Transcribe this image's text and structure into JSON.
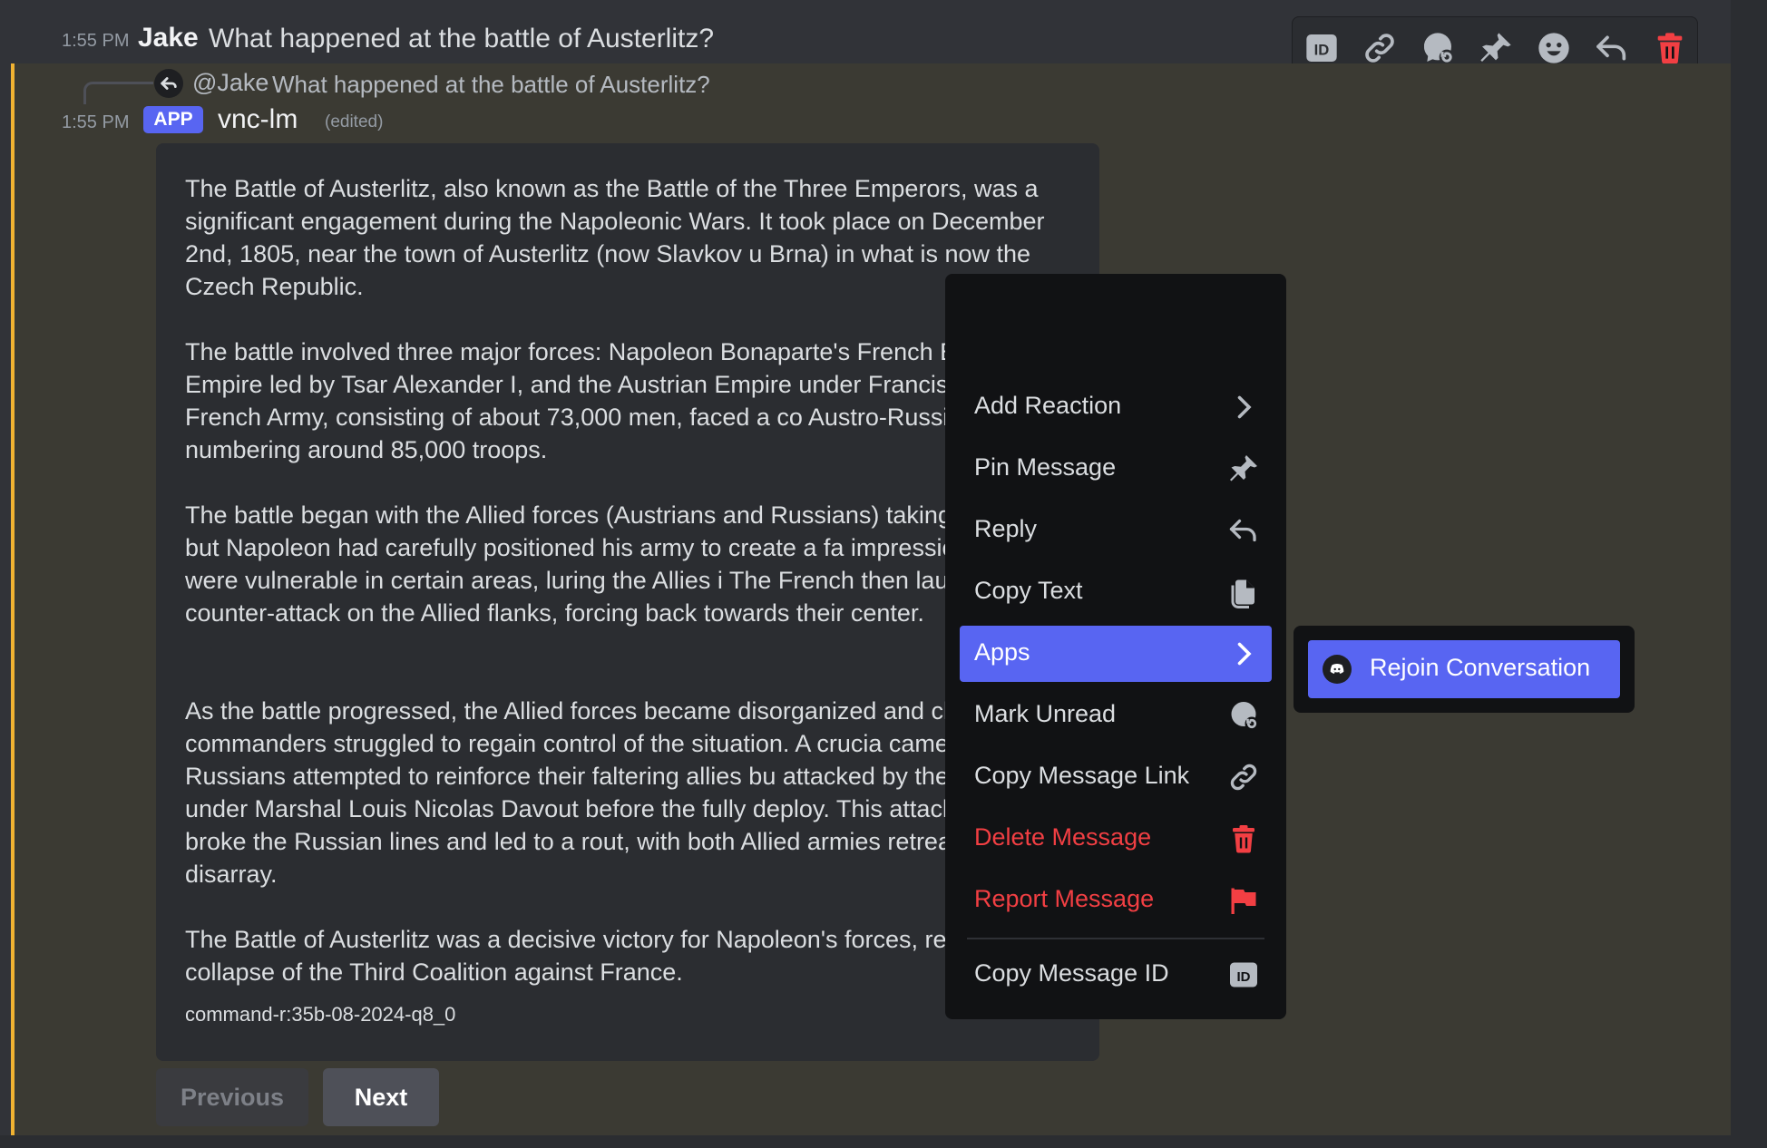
{
  "original_message": {
    "time": "1:55 PM",
    "author": "Jake",
    "text": "What happened at the battle of Austerlitz?"
  },
  "toolbar": {
    "icons": [
      "id-icon",
      "link-icon",
      "mark-unread-icon",
      "pin-icon",
      "emoji-icon",
      "reply-icon",
      "trash-icon"
    ]
  },
  "reply_reference": {
    "mention": "@Jake",
    "text": "What happened at the battle of Austerlitz?"
  },
  "bot_message": {
    "time": "1:55 PM",
    "badge": "APP",
    "author": "vnc-lm",
    "edited": "(edited)",
    "paragraphs": [
      "The Battle of Austerlitz, also known as the Battle of the Three Emperors, was a significant engagement during the Napoleonic Wars. It took place on December 2nd, 1805, near the town of Austerlitz (now Slavkov u Brna) in what is now the Czech Republic.",
      "The battle involved three major forces: Napoleon Bonaparte's French E Russian Empire led by Tsar Alexander I, and the Austrian Empire under Francis II. The French Army, consisting of about 73,000 men, faced a co Austro-Russian force numbering around 85,000 troops.",
      "The battle began with the Allied forces (Austrians and Russians) taking offensive, but Napoleon had carefully positioned his army to create a fa impression that they were vulnerable in certain areas, luring the Allies i The French then launched a counter-attack on the Allied flanks, forcing back towards their center.",
      "As the battle progressed, the Allied forces became disorganized and ch their commanders struggled to regain control of the situation. A crucia came when the Russians attempted to reinforce their faltering allies bu attacked by the French under Marshal Louis Nicolas Davout before the fully deploy. This attack effectively broke the Russian lines and led to a rout, with both Allied armies retreating in disarray.",
      "The Battle of Austerlitz was a decisive victory for Napoleon's forces, res the collapse of the Third Coalition against France."
    ],
    "footer": "command-r:35b-08-2024-q8_0",
    "buttons": {
      "previous": "Previous",
      "next": "Next"
    }
  },
  "context_menu": {
    "items": [
      {
        "label": "Add Reaction",
        "icon": "chevron-right-icon"
      },
      {
        "label": "Pin Message",
        "icon": "pin-icon"
      },
      {
        "label": "Reply",
        "icon": "reply-icon"
      },
      {
        "label": "Copy Text",
        "icon": "copy-icon"
      },
      {
        "label": "Apps",
        "icon": "chevron-right-icon",
        "active": true
      },
      {
        "label": "Mark Unread",
        "icon": "mark-unread-icon"
      },
      {
        "label": "Copy Message Link",
        "icon": "link-icon"
      },
      {
        "label": "Delete Message",
        "icon": "trash-icon",
        "danger": true
      },
      {
        "label": "Report Message",
        "icon": "flag-icon",
        "danger": true
      },
      {
        "label": "Copy Message ID",
        "icon": "id-icon"
      }
    ]
  },
  "apps_submenu": {
    "items": [
      {
        "label": "Rejoin Conversation",
        "icon": "discord-icon"
      }
    ]
  },
  "colors": {
    "accent": "#5865f2",
    "danger": "#f23f43",
    "highlight_bar": "#f0b232",
    "background": "#313338"
  }
}
